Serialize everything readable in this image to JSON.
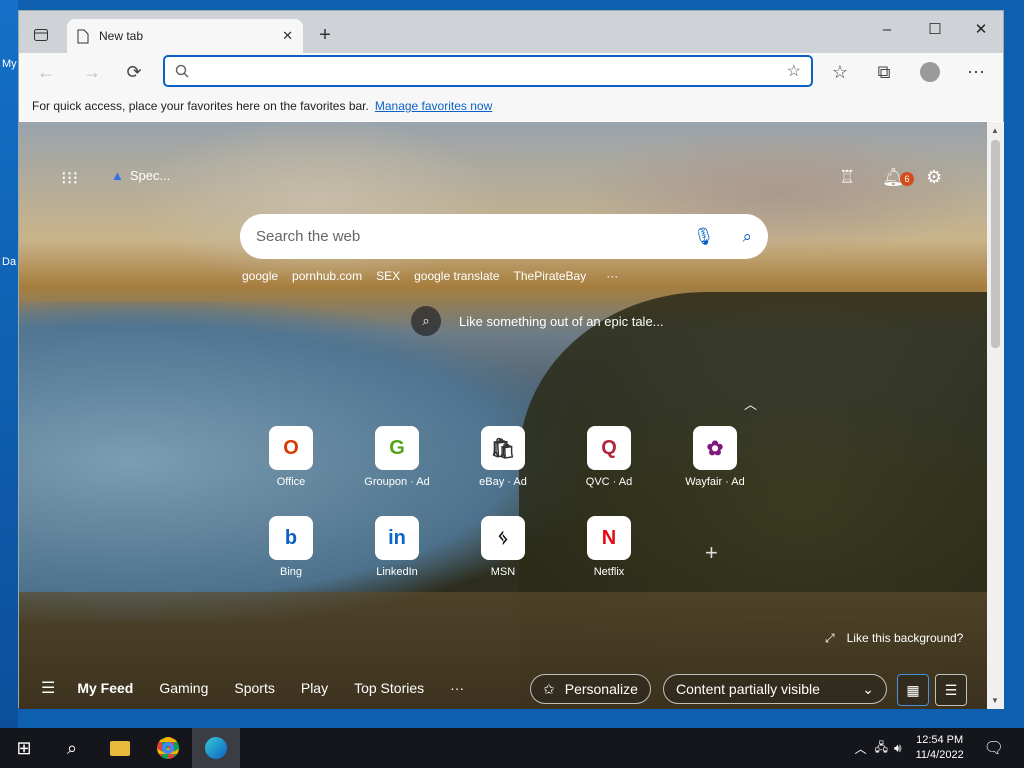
{
  "desktop": {
    "label_my": "My",
    "label_da": "Da"
  },
  "browser": {
    "tab_title": "New tab",
    "new_tab_icon": "+",
    "window_controls": {
      "minimize": "–",
      "maximize": "☐",
      "close": "✕"
    },
    "address": {
      "value": "",
      "placeholder": ""
    },
    "favbar": {
      "text": "For quick access, place your favorites here on the favorites bar.",
      "link": "Manage favorites now"
    }
  },
  "page": {
    "warning_text": "Spec...",
    "notification_count": "6",
    "search": {
      "placeholder": "Search the web"
    },
    "trending": [
      "google",
      "pornhub.com",
      "SEX",
      "google translate",
      "ThePirateBay",
      "···"
    ],
    "image_caption": "Like something out of an epic tale...",
    "tiles": [
      {
        "label": "Office",
        "icon": "office-icon",
        "glyph": "O",
        "color": "#d83b01"
      },
      {
        "label": "Groupon · Ad",
        "icon": "groupon-icon",
        "glyph": "G",
        "color": "#53a318"
      },
      {
        "label": "eBay · Ad",
        "icon": "ebay-icon",
        "glyph": "🛍",
        "color": "#333"
      },
      {
        "label": "QVC · Ad",
        "icon": "qvc-icon",
        "glyph": "Q",
        "color": "#b0263b"
      },
      {
        "label": "Wayfair · Ad",
        "icon": "wayfair-icon",
        "glyph": "✿",
        "color": "#7f187f"
      },
      {
        "label": "Bing",
        "icon": "bing-icon",
        "glyph": "b",
        "color": "#0b62c4"
      },
      {
        "label": "LinkedIn",
        "icon": "linkedin-icon",
        "glyph": "in",
        "color": "#0a66c2"
      },
      {
        "label": "MSN",
        "icon": "msn-icon",
        "glyph": "ᛃ",
        "color": "#111"
      },
      {
        "label": "Netflix",
        "icon": "netflix-icon",
        "glyph": "N",
        "color": "#e50914"
      }
    ],
    "like_background": "Like this background?",
    "feed": {
      "items": [
        "My Feed",
        "Gaming",
        "Sports",
        "Play",
        "Top Stories",
        "···"
      ],
      "personalize": "Personalize",
      "content_visibility": "Content partially visible"
    }
  },
  "taskbar": {
    "time": "12:54 PM",
    "date": "11/4/2022"
  }
}
